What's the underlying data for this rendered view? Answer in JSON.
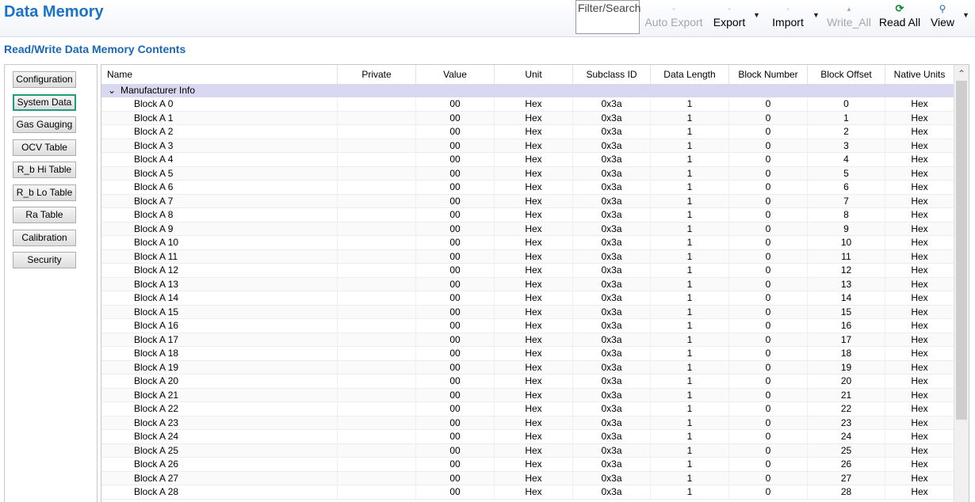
{
  "app": {
    "title": "Data Memory"
  },
  "toolbar": {
    "filter_label": "Filter/Search",
    "auto_export": "Auto Export",
    "export": "Export",
    "import": "Import",
    "write_all": "Write_All",
    "read_all": "Read All",
    "view": "View"
  },
  "section": {
    "title": "Read/Write Data Memory Contents"
  },
  "nav": [
    {
      "label": "Configuration",
      "active": false
    },
    {
      "label": "System Data",
      "active": true
    },
    {
      "label": "Gas Gauging",
      "active": false
    },
    {
      "label": "OCV Table",
      "active": false
    },
    {
      "label": "R_b Hi Table",
      "active": false
    },
    {
      "label": "R_b Lo Table",
      "active": false
    },
    {
      "label": "Ra Table",
      "active": false
    },
    {
      "label": "Calibration",
      "active": false
    },
    {
      "label": "Security",
      "active": false
    }
  ],
  "table": {
    "columns": [
      "Name",
      "Private",
      "Value",
      "Unit",
      "Subclass ID",
      "Data Length",
      "Block Number",
      "Block Offset",
      "Native Units"
    ],
    "group": "Manufacturer Info",
    "rows": [
      [
        "Block A 0",
        "",
        "00",
        "Hex",
        "0x3a",
        "1",
        "0",
        "0",
        "Hex"
      ],
      [
        "Block A 1",
        "",
        "00",
        "Hex",
        "0x3a",
        "1",
        "0",
        "1",
        "Hex"
      ],
      [
        "Block A 2",
        "",
        "00",
        "Hex",
        "0x3a",
        "1",
        "0",
        "2",
        "Hex"
      ],
      [
        "Block A 3",
        "",
        "00",
        "Hex",
        "0x3a",
        "1",
        "0",
        "3",
        "Hex"
      ],
      [
        "Block A 4",
        "",
        "00",
        "Hex",
        "0x3a",
        "1",
        "0",
        "4",
        "Hex"
      ],
      [
        "Block A 5",
        "",
        "00",
        "Hex",
        "0x3a",
        "1",
        "0",
        "5",
        "Hex"
      ],
      [
        "Block A 6",
        "",
        "00",
        "Hex",
        "0x3a",
        "1",
        "0",
        "6",
        "Hex"
      ],
      [
        "Block A 7",
        "",
        "00",
        "Hex",
        "0x3a",
        "1",
        "0",
        "7",
        "Hex"
      ],
      [
        "Block A 8",
        "",
        "00",
        "Hex",
        "0x3a",
        "1",
        "0",
        "8",
        "Hex"
      ],
      [
        "Block A 9",
        "",
        "00",
        "Hex",
        "0x3a",
        "1",
        "0",
        "9",
        "Hex"
      ],
      [
        "Block A 10",
        "",
        "00",
        "Hex",
        "0x3a",
        "1",
        "0",
        "10",
        "Hex"
      ],
      [
        "Block A 11",
        "",
        "00",
        "Hex",
        "0x3a",
        "1",
        "0",
        "11",
        "Hex"
      ],
      [
        "Block A 12",
        "",
        "00",
        "Hex",
        "0x3a",
        "1",
        "0",
        "12",
        "Hex"
      ],
      [
        "Block A 13",
        "",
        "00",
        "Hex",
        "0x3a",
        "1",
        "0",
        "13",
        "Hex"
      ],
      [
        "Block A 14",
        "",
        "00",
        "Hex",
        "0x3a",
        "1",
        "0",
        "14",
        "Hex"
      ],
      [
        "Block A 15",
        "",
        "00",
        "Hex",
        "0x3a",
        "1",
        "0",
        "15",
        "Hex"
      ],
      [
        "Block A 16",
        "",
        "00",
        "Hex",
        "0x3a",
        "1",
        "0",
        "16",
        "Hex"
      ],
      [
        "Block A 17",
        "",
        "00",
        "Hex",
        "0x3a",
        "1",
        "0",
        "17",
        "Hex"
      ],
      [
        "Block A 18",
        "",
        "00",
        "Hex",
        "0x3a",
        "1",
        "0",
        "18",
        "Hex"
      ],
      [
        "Block A 19",
        "",
        "00",
        "Hex",
        "0x3a",
        "1",
        "0",
        "19",
        "Hex"
      ],
      [
        "Block A 20",
        "",
        "00",
        "Hex",
        "0x3a",
        "1",
        "0",
        "20",
        "Hex"
      ],
      [
        "Block A 21",
        "",
        "00",
        "Hex",
        "0x3a",
        "1",
        "0",
        "21",
        "Hex"
      ],
      [
        "Block A 22",
        "",
        "00",
        "Hex",
        "0x3a",
        "1",
        "0",
        "22",
        "Hex"
      ],
      [
        "Block A 23",
        "",
        "00",
        "Hex",
        "0x3a",
        "1",
        "0",
        "23",
        "Hex"
      ],
      [
        "Block A 24",
        "",
        "00",
        "Hex",
        "0x3a",
        "1",
        "0",
        "24",
        "Hex"
      ],
      [
        "Block A 25",
        "",
        "00",
        "Hex",
        "0x3a",
        "1",
        "0",
        "25",
        "Hex"
      ],
      [
        "Block A 26",
        "",
        "00",
        "Hex",
        "0x3a",
        "1",
        "0",
        "26",
        "Hex"
      ],
      [
        "Block A 27",
        "",
        "00",
        "Hex",
        "0x3a",
        "1",
        "0",
        "27",
        "Hex"
      ],
      [
        "Block A 28",
        "",
        "00",
        "Hex",
        "0x3a",
        "1",
        "0",
        "28",
        "Hex"
      ]
    ]
  },
  "icons": {
    "auto_export": "auto-export-icon",
    "export": "export-icon",
    "import": "import-icon",
    "write_all": "write-all-icon",
    "read_all": "refresh-icon",
    "view": "view-search-icon",
    "expand": "chevron-down-icon",
    "scroll_up": "scroll-up-arrow-icon"
  },
  "colors": {
    "title": "#1a73c9",
    "group_row_bg": "#d8d8f0",
    "active_nav_border": "#1f9c7e"
  }
}
